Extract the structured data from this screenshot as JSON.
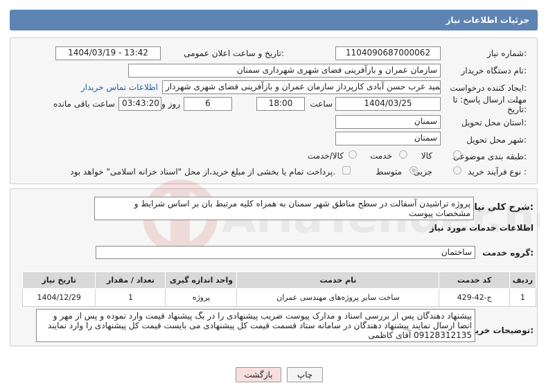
{
  "header": {
    "title": "جزئیات اطلاعات نیاز"
  },
  "form": {
    "need_number_label": "شماره نیاز:",
    "need_number": "1104090687000062",
    "announce_label": "تاریخ و ساعت اعلان عمومی:",
    "announce_value": "1404/03/19 - 13:42",
    "buyer_org_label": "نام دستگاه خریدار:",
    "buyer_org": "سازمان عمران و بازآفرینی فضای شهری شهرداری سمنان",
    "creator_label": "ایجاد کننده درخواست:",
    "creator": "حمید عرب حسن آبادی کارپرداز سازمان عمران و بازآفرینی فضای شهری شهردار",
    "contact_link": "اطلاعات تماس خریدار",
    "deadline_label_1": "مهلت ارسال پاسخ: تا",
    "deadline_label_2": "تاریخ:",
    "deadline_date": "1404/03/25",
    "time_label": "ساعت",
    "deadline_time": "18:00",
    "days_value": "6",
    "days_label": "روز و",
    "remaining_time": "03:43:20",
    "remaining_label": "ساعت باقی مانده",
    "province_label": "استان محل تحویل:",
    "province": "سمنان",
    "city_label": "شهر محل تحویل:",
    "city": "سمنان",
    "category_label": "طبقه بندی موضوعی:",
    "category_options": [
      "کالا",
      "خدمت",
      "کالا/خدمت"
    ],
    "process_label": "نوع فرآیند خرید :",
    "process_options": [
      "جزیی",
      "متوسط"
    ],
    "payment_note": "پرداخت تمام یا بخشی از مبلغ خرید،از محل \"اسناد خزانه اسلامی\" خواهد بود."
  },
  "description": {
    "label": "شرح کلی نیاز:",
    "text": "پروژه تراشیدن آسفالت  در سطح مناطق شهر سمنان به همراه کلیه مرتبط بان بر اساس شرایط و مشخصات پیوست"
  },
  "services": {
    "section_title": "اطلاعات خدمات مورد نیاز",
    "group_label": "گروه خدمت:",
    "group_value": "ساختمان",
    "columns": [
      "ردیف",
      "کد خدمت",
      "نام خدمت",
      "واحد اندازه گیری",
      "تعداد / مقدار",
      "تاریخ نیاز"
    ],
    "rows": [
      [
        "1",
        "ج-42-429",
        "ساخت سایر پروژه‌های مهندسی عمران",
        "پروژه",
        "1",
        "1404/12/29"
      ]
    ]
  },
  "buyer_notes": {
    "label": "توضیحات خریدار:",
    "text": "پیشنهاد دهندگان پس از بررسی اسناد و مدارک پیوست ضریب پیشنهادی را در بگ پیشنهاد قیمت وارد نموده و پس از مهر و انضا ارسال نمایند پیشنهاد دهندگان در سامانه ستاد قسمت قیمت کل پیشنهادی می بایست قیمت کل پیشنهادی را وارد نمایند 09128312135 آقای کاظمی"
  },
  "buttons": {
    "print": "چاپ",
    "back": "بازگشت"
  },
  "watermark": {
    "text": "AriaTender.neT"
  },
  "colors": {
    "header_bg": "#5e84b4",
    "link": "#1f5fa8",
    "back_button_bg": "#f8dede"
  }
}
